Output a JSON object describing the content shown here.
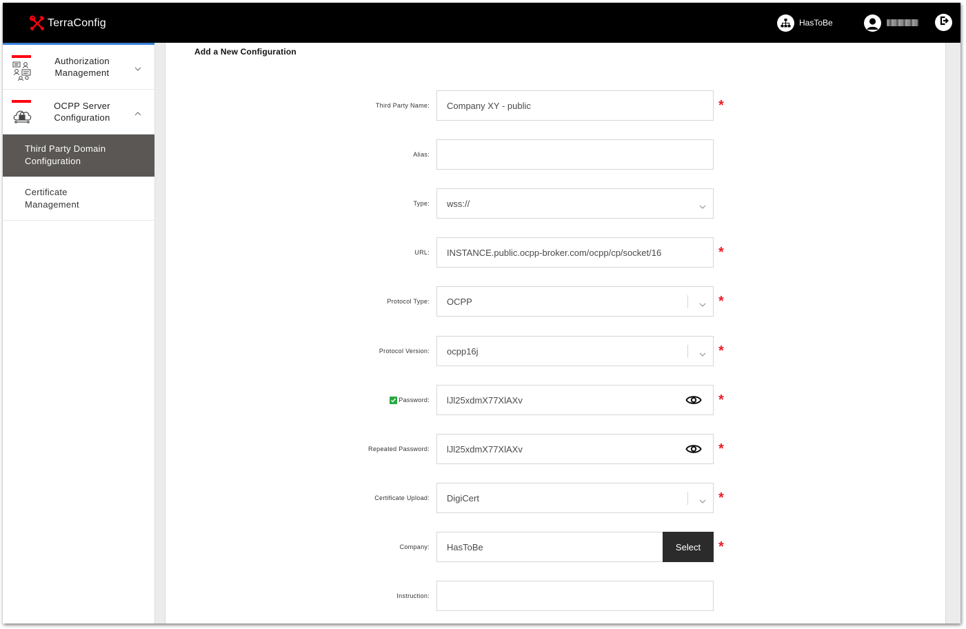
{
  "app": {
    "brand_name": "TerraConfig",
    "brand_color": "#ff000f",
    "organization": "HasToBe",
    "user_name": "",
    "icons": {
      "brand": "tools-icon",
      "organization": "org-chart-icon",
      "user": "user-avatar-icon",
      "logout": "logout-icon"
    }
  },
  "sidebar": {
    "accent_color": "#3b7fd9",
    "items": [
      {
        "label": "Authorization\nManagement",
        "icon": "authorization-icon",
        "expanded": false
      },
      {
        "label": "OCPP Server\nConfiguration",
        "icon": "cloud-lock-icon",
        "expanded": true
      }
    ],
    "sub_items": [
      {
        "label": "Third Party Domain\nConfiguration",
        "active": true
      },
      {
        "label": "Certificate\nManagement",
        "active": false
      }
    ]
  },
  "form": {
    "title": "Add a New Configuration",
    "required_marker": "*",
    "required_color": "#ee1c25",
    "fields": {
      "third_party_name": {
        "label": "Third Party Name:",
        "value": "Company XY - public",
        "required": true
      },
      "alias": {
        "label": "Alias:",
        "value": "",
        "required": false
      },
      "type": {
        "label": "Type:",
        "value": "wss://",
        "required": false
      },
      "url": {
        "label": "URL:",
        "value": "INSTANCE.public.ocpp-broker.com/ocpp/cp/socket/16",
        "required": true
      },
      "protocol_type": {
        "label": "Protocol Type:",
        "value": "OCPP",
        "required": true
      },
      "protocol_version": {
        "label": "Protocol Version:",
        "value": "ocpp16j",
        "required": true
      },
      "password": {
        "label": "Password:",
        "value": "lJl25xdmX77XlAXv",
        "checked": true,
        "required": true
      },
      "repeated_password": {
        "label": "Repeated Password:",
        "value": "lJl25xdmX77XlAXv",
        "required": true
      },
      "certificate_upload": {
        "label": "Certificate Upload:",
        "value": "DigiCert",
        "required": true
      },
      "company": {
        "label": "Company:",
        "value": "HasToBe",
        "button_label": "Select",
        "required": true
      },
      "instruction": {
        "label": "Instruction:",
        "value": "",
        "required": false
      }
    }
  }
}
